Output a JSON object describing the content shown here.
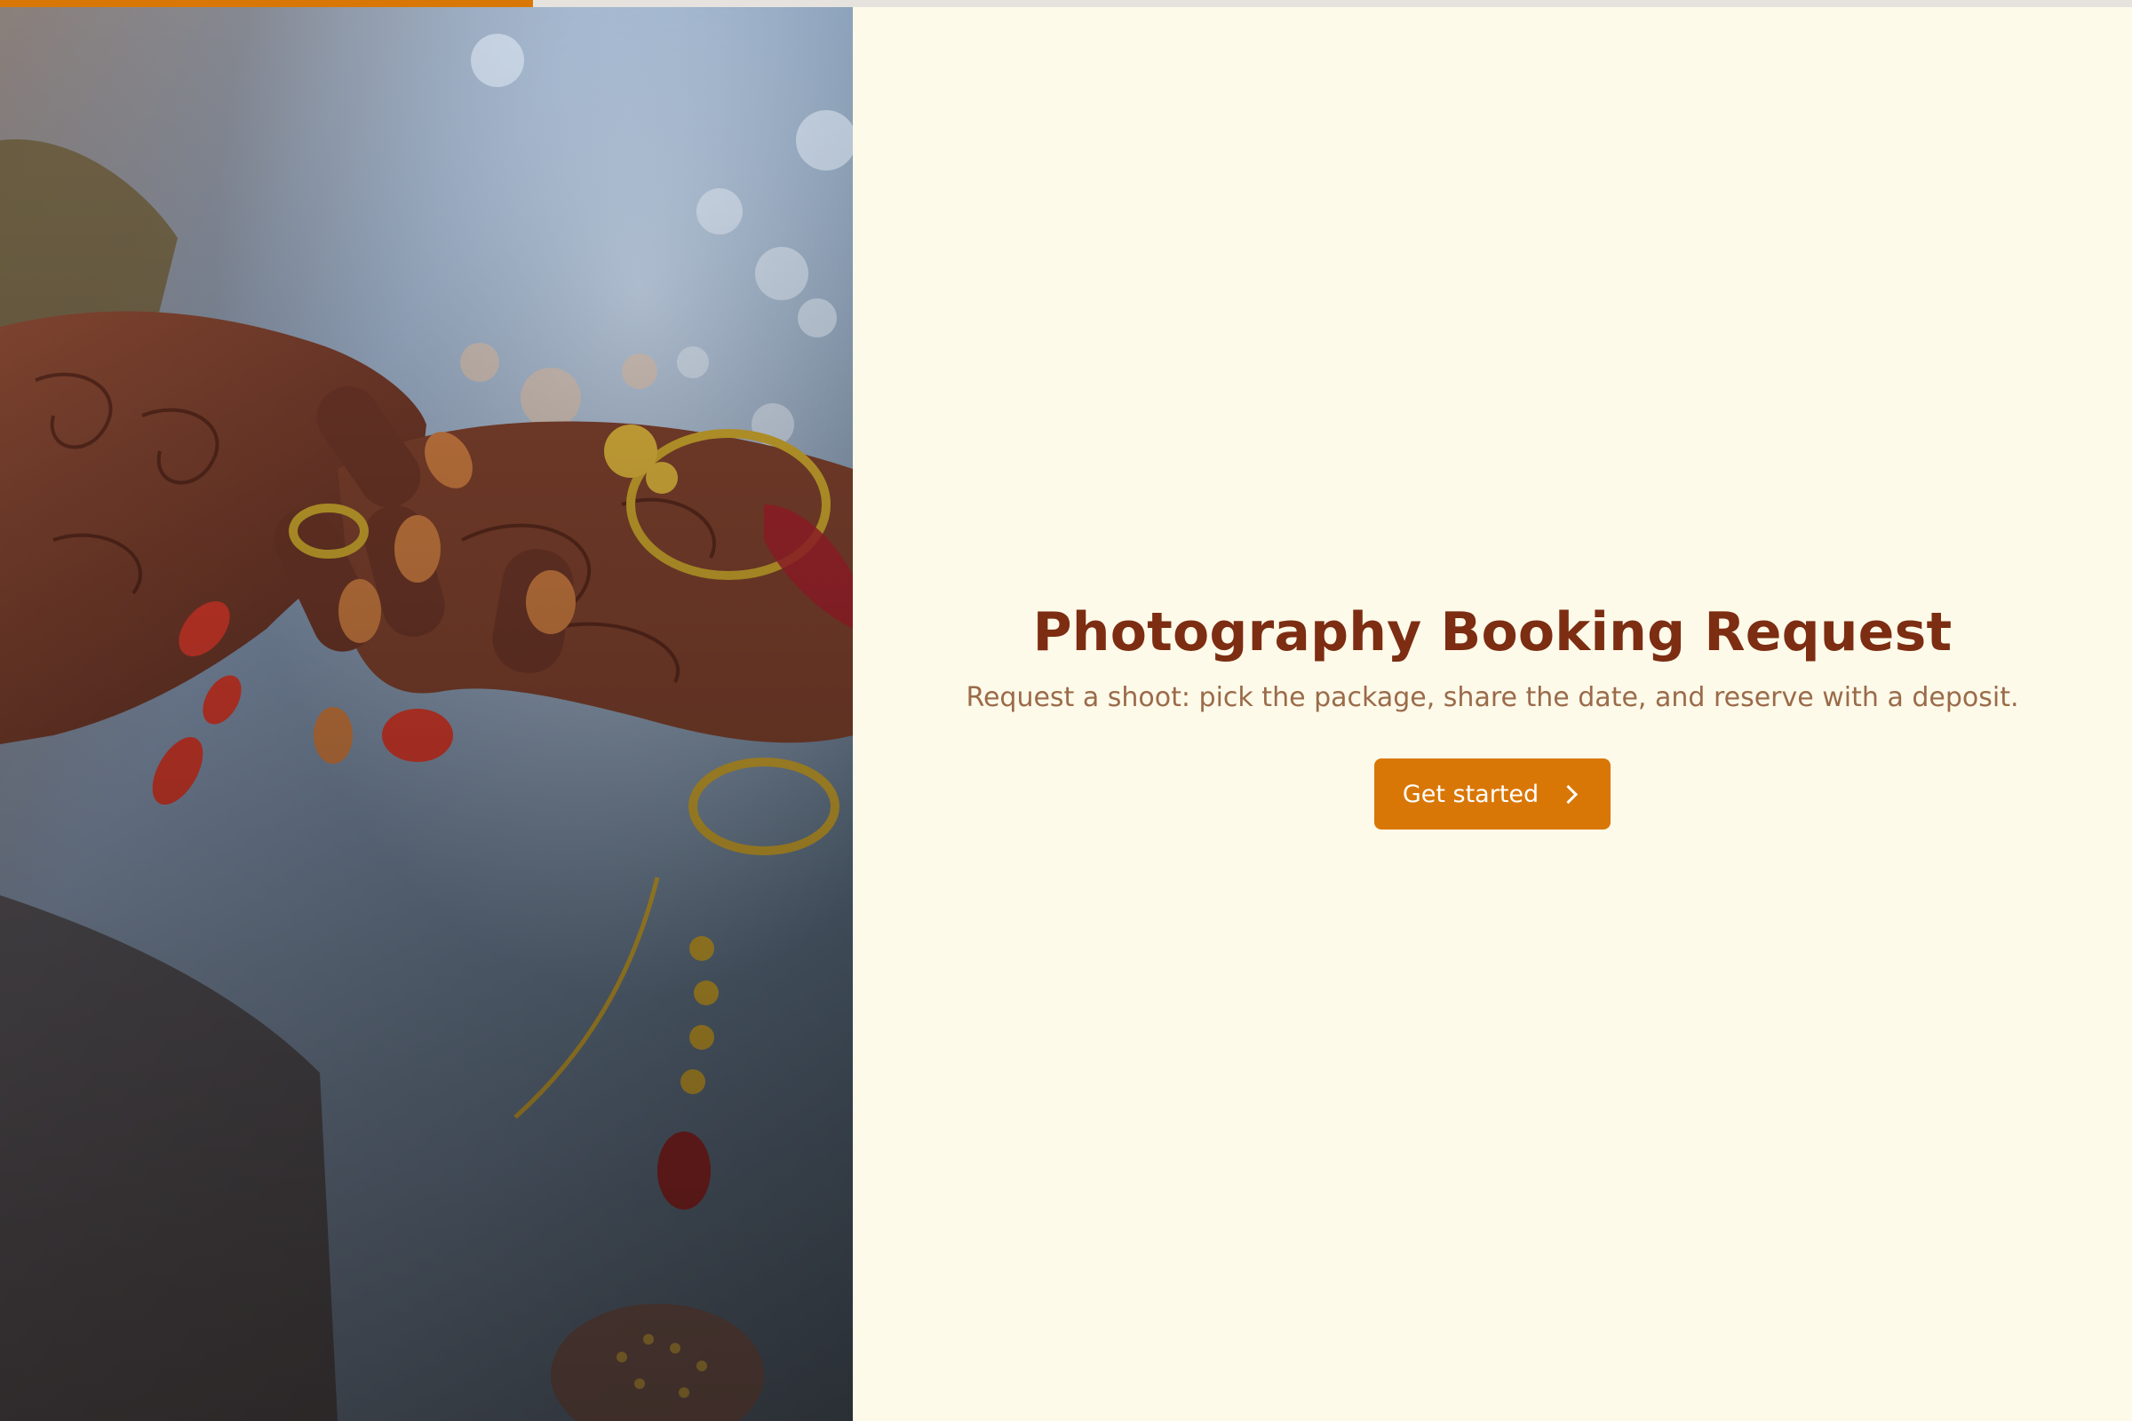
{
  "progress": {
    "fraction": 0.25,
    "color": "#D97706"
  },
  "hero": {
    "image_subject": "hands-with-henna-photo"
  },
  "main": {
    "title": "Photography Booking Request",
    "subtitle": "Request a shoot: pick the package, share the date, and reserve with a deposit.",
    "cta_label": "Get started",
    "cta_icon": "chevron-right-icon"
  },
  "colors": {
    "background": "#FEFAE9",
    "title": "#7C2D12",
    "subtitle": "#9A6B4A",
    "accent": "#D97706"
  }
}
